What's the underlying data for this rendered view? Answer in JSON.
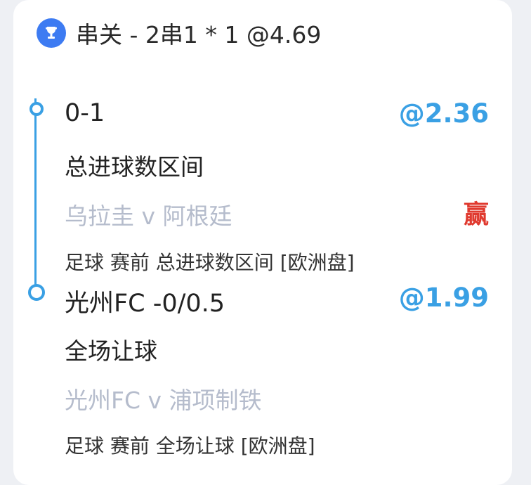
{
  "header": {
    "icon": "trophy-icon",
    "title": "串关 - 2串1 * 1 @4.69"
  },
  "colors": {
    "accent": "#3aa0e4",
    "win": "#e03a2f",
    "muted": "#b5bccc"
  },
  "legs": [
    {
      "selection": "0-1",
      "odds": "@2.36",
      "market": "总进球数区间",
      "match": "乌拉圭 v 阿根廷",
      "result": "赢",
      "meta": "足球 赛前   总进球数区间 [欧洲盘]"
    },
    {
      "selection": "光州FC -0/0.5",
      "odds": "@1.99",
      "market": "全场让球",
      "match": "光州FC v 浦项制铁",
      "meta": "足球 赛前   全场让球 [欧洲盘]"
    }
  ]
}
